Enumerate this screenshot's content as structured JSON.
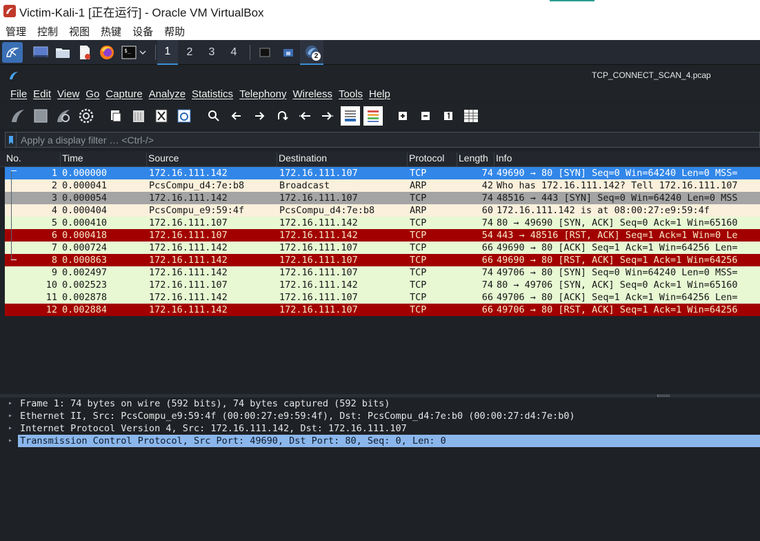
{
  "host_window": {
    "title": "Victim-Kali-1 [正在运行] - Oracle VM VirtualBox",
    "menu": [
      "管理",
      "控制",
      "视图",
      "热键",
      "设备",
      "帮助"
    ]
  },
  "kali_panel": {
    "workspaces": [
      "1",
      "2",
      "3",
      "4"
    ],
    "active_workspace": "1",
    "badge": "2"
  },
  "wireshark": {
    "window_title": "TCP_CONNECT_SCAN_4.pcap",
    "menu": [
      "File",
      "Edit",
      "View",
      "Go",
      "Capture",
      "Analyze",
      "Statistics",
      "Telephony",
      "Wireless",
      "Tools",
      "Help"
    ],
    "filter_placeholder": "Apply a display filter … <Ctrl-/>",
    "columns": [
      "No.",
      "Time",
      "Source",
      "Destination",
      "Protocol",
      "Length",
      "Info"
    ],
    "packets": [
      {
        "no": "1",
        "time": "0.000000",
        "src": "172.16.111.142",
        "dst": "172.16.111.107",
        "proto": "TCP",
        "len": "74",
        "info": "49690 → 80 [SYN] Seq=0 Win=64240 Len=0 MSS=",
        "style": "sel"
      },
      {
        "no": "2",
        "time": "0.000041",
        "src": "PcsCompu_d4:7e:b8",
        "dst": "Broadcast",
        "proto": "ARP",
        "len": "42",
        "info": "Who has 172.16.111.142? Tell 172.16.111.107",
        "style": "arp"
      },
      {
        "no": "3",
        "time": "0.000054",
        "src": "172.16.111.142",
        "dst": "172.16.111.107",
        "proto": "TCP",
        "len": "74",
        "info": "48516 → 443 [SYN] Seq=0 Win=64240 Len=0 MSS",
        "style": "gray"
      },
      {
        "no": "4",
        "time": "0.000404",
        "src": "PcsCompu_e9:59:4f",
        "dst": "PcsCompu_d4:7e:b8",
        "proto": "ARP",
        "len": "60",
        "info": "172.16.111.142 is at 08:00:27:e9:59:4f",
        "style": "arp"
      },
      {
        "no": "5",
        "time": "0.000410",
        "src": "172.16.111.107",
        "dst": "172.16.111.142",
        "proto": "TCP",
        "len": "74",
        "info": "80 → 49690 [SYN, ACK] Seq=0 Ack=1 Win=65160",
        "style": "tcp"
      },
      {
        "no": "6",
        "time": "0.000418",
        "src": "172.16.111.107",
        "dst": "172.16.111.142",
        "proto": "TCP",
        "len": "54",
        "info": "443 → 48516 [RST, ACK] Seq=1 Ack=1 Win=0 Le",
        "style": "rst"
      },
      {
        "no": "7",
        "time": "0.000724",
        "src": "172.16.111.142",
        "dst": "172.16.111.107",
        "proto": "TCP",
        "len": "66",
        "info": "49690 → 80 [ACK] Seq=1 Ack=1 Win=64256 Len=",
        "style": "tcp"
      },
      {
        "no": "8",
        "time": "0.000863",
        "src": "172.16.111.142",
        "dst": "172.16.111.107",
        "proto": "TCP",
        "len": "66",
        "info": "49690 → 80 [RST, ACK] Seq=1 Ack=1 Win=64256",
        "style": "rst"
      },
      {
        "no": "9",
        "time": "0.002497",
        "src": "172.16.111.142",
        "dst": "172.16.111.107",
        "proto": "TCP",
        "len": "74",
        "info": "49706 → 80 [SYN] Seq=0 Win=64240 Len=0 MSS=",
        "style": "tcp"
      },
      {
        "no": "10",
        "time": "0.002523",
        "src": "172.16.111.107",
        "dst": "172.16.111.142",
        "proto": "TCP",
        "len": "74",
        "info": "80 → 49706 [SYN, ACK] Seq=0 Ack=1 Win=65160",
        "style": "tcp"
      },
      {
        "no": "11",
        "time": "0.002878",
        "src": "172.16.111.142",
        "dst": "172.16.111.107",
        "proto": "TCP",
        "len": "66",
        "info": "49706 → 80 [ACK] Seq=1 Ack=1 Win=64256 Len=",
        "style": "tcp"
      },
      {
        "no": "12",
        "time": "0.002884",
        "src": "172.16.111.142",
        "dst": "172.16.111.107",
        "proto": "TCP",
        "len": "66",
        "info": "49706 → 80 [RST, ACK] Seq=1 Ack=1 Win=64256",
        "style": "rst"
      }
    ],
    "details": [
      {
        "text": "Frame 1: 74 bytes on wire (592 bits), 74 bytes captured (592 bits)",
        "selected": false
      },
      {
        "text": "Ethernet II, Src: PcsCompu_e9:59:4f (00:00:27:e9:59:4f), Dst: PcsCompu_d4:7e:b0 (00:00:27:d4:7e:b0)",
        "selected": false
      },
      {
        "text": "Internet Protocol Version 4, Src: 172.16.111.142, Dst: 172.16.111.107",
        "selected": false
      },
      {
        "text": "Transmission Control Protocol, Src Port: 49690, Dst Port: 80, Seq: 0, Len: 0",
        "selected": true
      }
    ]
  }
}
